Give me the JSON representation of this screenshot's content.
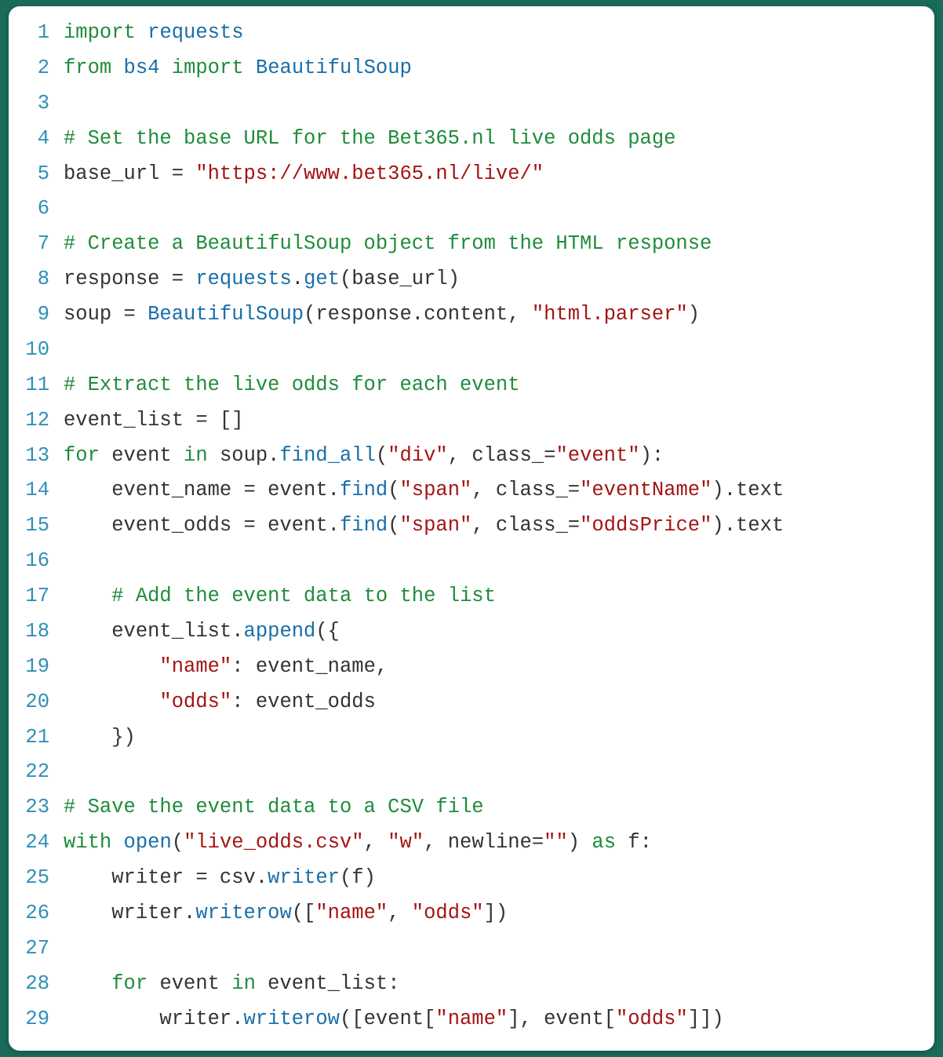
{
  "code": {
    "lines": [
      {
        "n": "1",
        "tokens": [
          {
            "t": "import",
            "c": "kw"
          },
          {
            "t": " ",
            "c": "txt"
          },
          {
            "t": "requests",
            "c": "mod"
          }
        ]
      },
      {
        "n": "2",
        "tokens": [
          {
            "t": "from",
            "c": "kw"
          },
          {
            "t": " ",
            "c": "txt"
          },
          {
            "t": "bs4",
            "c": "mod"
          },
          {
            "t": " ",
            "c": "txt"
          },
          {
            "t": "import",
            "c": "kw"
          },
          {
            "t": " ",
            "c": "txt"
          },
          {
            "t": "BeautifulSoup",
            "c": "mod"
          }
        ]
      },
      {
        "n": "3",
        "tokens": []
      },
      {
        "n": "4",
        "tokens": [
          {
            "t": "# Set the base URL for the Bet365.nl live odds page",
            "c": "cmt"
          }
        ]
      },
      {
        "n": "5",
        "tokens": [
          {
            "t": "base_url = ",
            "c": "txt"
          },
          {
            "t": "\"https://www.bet365.nl/live/\"",
            "c": "str"
          }
        ]
      },
      {
        "n": "6",
        "tokens": []
      },
      {
        "n": "7",
        "tokens": [
          {
            "t": "# Create a BeautifulSoup object from the HTML response",
            "c": "cmt"
          }
        ]
      },
      {
        "n": "8",
        "tokens": [
          {
            "t": "response = ",
            "c": "txt"
          },
          {
            "t": "requests",
            "c": "mod"
          },
          {
            "t": ".",
            "c": "txt"
          },
          {
            "t": "get",
            "c": "fn"
          },
          {
            "t": "(base_url)",
            "c": "txt"
          }
        ]
      },
      {
        "n": "9",
        "tokens": [
          {
            "t": "soup = ",
            "c": "txt"
          },
          {
            "t": "BeautifulSoup",
            "c": "mod"
          },
          {
            "t": "(response.content, ",
            "c": "txt"
          },
          {
            "t": "\"html.parser\"",
            "c": "str"
          },
          {
            "t": ")",
            "c": "txt"
          }
        ]
      },
      {
        "n": "10",
        "tokens": []
      },
      {
        "n": "11",
        "tokens": [
          {
            "t": "# Extract the live odds for each event",
            "c": "cmt"
          }
        ]
      },
      {
        "n": "12",
        "tokens": [
          {
            "t": "event_list = []",
            "c": "txt"
          }
        ]
      },
      {
        "n": "13",
        "tokens": [
          {
            "t": "for",
            "c": "kw"
          },
          {
            "t": " event ",
            "c": "txt"
          },
          {
            "t": "in",
            "c": "kw"
          },
          {
            "t": " soup.",
            "c": "txt"
          },
          {
            "t": "find_all",
            "c": "fn"
          },
          {
            "t": "(",
            "c": "txt"
          },
          {
            "t": "\"div\"",
            "c": "str"
          },
          {
            "t": ", class_=",
            "c": "txt"
          },
          {
            "t": "\"event\"",
            "c": "str"
          },
          {
            "t": "):",
            "c": "txt"
          }
        ]
      },
      {
        "n": "14",
        "tokens": [
          {
            "t": "    event_name = event.",
            "c": "txt"
          },
          {
            "t": "find",
            "c": "fn"
          },
          {
            "t": "(",
            "c": "txt"
          },
          {
            "t": "\"span\"",
            "c": "str"
          },
          {
            "t": ", class_=",
            "c": "txt"
          },
          {
            "t": "\"eventName\"",
            "c": "str"
          },
          {
            "t": ").text",
            "c": "txt"
          }
        ]
      },
      {
        "n": "15",
        "tokens": [
          {
            "t": "    event_odds = event.",
            "c": "txt"
          },
          {
            "t": "find",
            "c": "fn"
          },
          {
            "t": "(",
            "c": "txt"
          },
          {
            "t": "\"span\"",
            "c": "str"
          },
          {
            "t": ", class_=",
            "c": "txt"
          },
          {
            "t": "\"oddsPrice\"",
            "c": "str"
          },
          {
            "t": ").text",
            "c": "txt"
          }
        ]
      },
      {
        "n": "16",
        "tokens": []
      },
      {
        "n": "17",
        "tokens": [
          {
            "t": "    ",
            "c": "txt"
          },
          {
            "t": "# Add the event data to the list",
            "c": "cmt"
          }
        ]
      },
      {
        "n": "18",
        "tokens": [
          {
            "t": "    event_list.",
            "c": "txt"
          },
          {
            "t": "append",
            "c": "fn"
          },
          {
            "t": "({",
            "c": "txt"
          }
        ]
      },
      {
        "n": "19",
        "tokens": [
          {
            "t": "        ",
            "c": "txt"
          },
          {
            "t": "\"name\"",
            "c": "str"
          },
          {
            "t": ": event_name,",
            "c": "txt"
          }
        ]
      },
      {
        "n": "20",
        "tokens": [
          {
            "t": "        ",
            "c": "txt"
          },
          {
            "t": "\"odds\"",
            "c": "str"
          },
          {
            "t": ": event_odds",
            "c": "txt"
          }
        ]
      },
      {
        "n": "21",
        "tokens": [
          {
            "t": "    })",
            "c": "txt"
          }
        ]
      },
      {
        "n": "22",
        "tokens": []
      },
      {
        "n": "23",
        "tokens": [
          {
            "t": "# Save the event data to a CSV file",
            "c": "cmt"
          }
        ]
      },
      {
        "n": "24",
        "tokens": [
          {
            "t": "with",
            "c": "kw"
          },
          {
            "t": " ",
            "c": "txt"
          },
          {
            "t": "open",
            "c": "fn"
          },
          {
            "t": "(",
            "c": "txt"
          },
          {
            "t": "\"live_odds.csv\"",
            "c": "str"
          },
          {
            "t": ", ",
            "c": "txt"
          },
          {
            "t": "\"w\"",
            "c": "str"
          },
          {
            "t": ", newline=",
            "c": "txt"
          },
          {
            "t": "\"\"",
            "c": "str"
          },
          {
            "t": ") ",
            "c": "txt"
          },
          {
            "t": "as",
            "c": "kw"
          },
          {
            "t": " f:",
            "c": "txt"
          }
        ]
      },
      {
        "n": "25",
        "tokens": [
          {
            "t": "    writer = csv.",
            "c": "txt"
          },
          {
            "t": "writer",
            "c": "fn"
          },
          {
            "t": "(f)",
            "c": "txt"
          }
        ]
      },
      {
        "n": "26",
        "tokens": [
          {
            "t": "    writer.",
            "c": "txt"
          },
          {
            "t": "writerow",
            "c": "fn"
          },
          {
            "t": "([",
            "c": "txt"
          },
          {
            "t": "\"name\"",
            "c": "str"
          },
          {
            "t": ", ",
            "c": "txt"
          },
          {
            "t": "\"odds\"",
            "c": "str"
          },
          {
            "t": "])",
            "c": "txt"
          }
        ]
      },
      {
        "n": "27",
        "tokens": []
      },
      {
        "n": "28",
        "tokens": [
          {
            "t": "    ",
            "c": "txt"
          },
          {
            "t": "for",
            "c": "kw"
          },
          {
            "t": " event ",
            "c": "txt"
          },
          {
            "t": "in",
            "c": "kw"
          },
          {
            "t": " event_list:",
            "c": "txt"
          }
        ]
      },
      {
        "n": "29",
        "tokens": [
          {
            "t": "        writer.",
            "c": "txt"
          },
          {
            "t": "writerow",
            "c": "fn"
          },
          {
            "t": "([event[",
            "c": "txt"
          },
          {
            "t": "\"name\"",
            "c": "str"
          },
          {
            "t": "], event[",
            "c": "txt"
          },
          {
            "t": "\"odds\"",
            "c": "str"
          },
          {
            "t": "]])",
            "c": "txt"
          }
        ]
      }
    ]
  }
}
